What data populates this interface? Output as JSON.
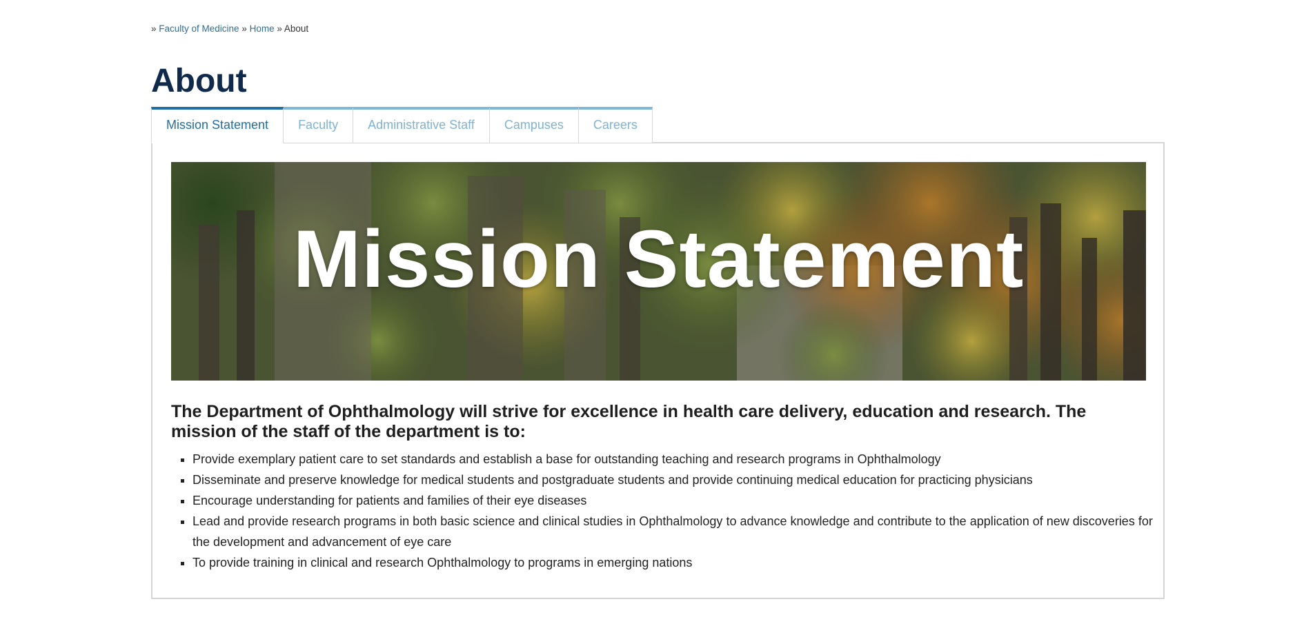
{
  "breadcrumb": {
    "items": [
      {
        "label": "Faculty of Medicine",
        "link": true
      },
      {
        "label": "Home",
        "link": true
      },
      {
        "label": "About",
        "link": false
      }
    ],
    "separator": "»"
  },
  "page": {
    "title": "About"
  },
  "tabs": [
    {
      "label": "Mission Statement",
      "active": true
    },
    {
      "label": "Faculty",
      "active": false
    },
    {
      "label": "Administrative Staff",
      "active": false
    },
    {
      "label": "Campuses",
      "active": false
    },
    {
      "label": "Careers",
      "active": false
    }
  ],
  "banner": {
    "title": "Mission Statement"
  },
  "content": {
    "intro": "The Department of Ophthalmology will strive for excellence in health care delivery, education and research. The mission of the staff of the department is to:",
    "items": [
      "Provide exemplary patient care to set standards and establish a base for outstanding teaching and research programs in Ophthalmology",
      "Disseminate and preserve knowledge for medical students and postgraduate students and provide continuing medical education for practicing physicians",
      "Encourage understanding for patients and families of their eye diseases",
      "Lead and provide research programs in both basic science and clinical studies in Ophthalmology to advance knowledge and contribute to the application of new discoveries for the development and advancement of eye care",
      "To provide training in clinical and research Ophthalmology to programs in emerging nations"
    ]
  },
  "colors": {
    "title": "#0f2a4a",
    "tab_active": "#1f6fa5",
    "tab_inactive": "#7fb3cf",
    "link": "#2f6f93",
    "panel_border": "#d4d4d4"
  }
}
